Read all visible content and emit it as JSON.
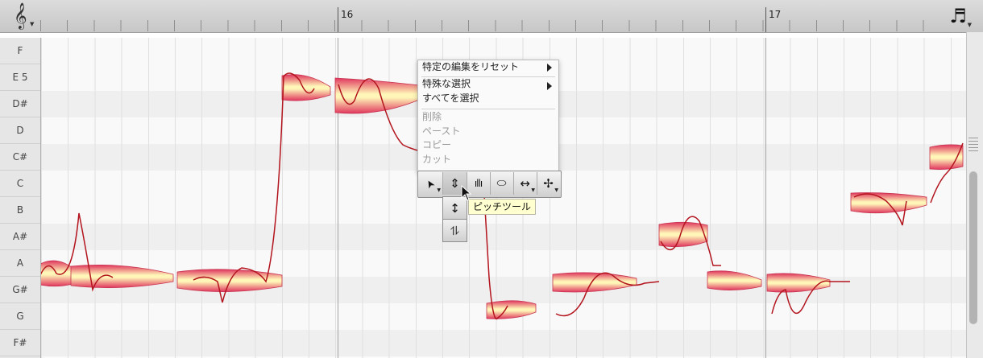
{
  "ruler": {
    "bar_labels": [
      "16",
      "17"
    ],
    "clef_icon": "treble-clef-icon",
    "note_icon": "music-note-icon"
  },
  "keys": [
    "F",
    "E 5",
    "D#",
    "D",
    "C#",
    "C",
    "B",
    "A#",
    "A",
    "G#",
    "G",
    "F#"
  ],
  "context_menu": {
    "items": [
      {
        "label": "特定の編集をリセット",
        "submenu": true,
        "enabled": true
      },
      {
        "label": "特殊な選択",
        "submenu": true,
        "enabled": true
      },
      {
        "label": "すべてを選択",
        "submenu": false,
        "enabled": true
      },
      {
        "label": "削除",
        "submenu": false,
        "enabled": false
      },
      {
        "label": "ペースト",
        "submenu": false,
        "enabled": false
      },
      {
        "label": "コピー",
        "submenu": false,
        "enabled": false
      },
      {
        "label": "カット",
        "submenu": false,
        "enabled": false
      }
    ]
  },
  "toolbar": {
    "tools": [
      {
        "name": "arrow-tool-icon",
        "glyph": "➤"
      },
      {
        "name": "pitch-tool-icon",
        "glyph": "⇕"
      },
      {
        "name": "amplitude-tool-icon",
        "glyph": "ıllı"
      },
      {
        "name": "formant-tool-icon",
        "glyph": "⬭"
      },
      {
        "name": "timing-tool-icon",
        "glyph": "↔"
      },
      {
        "name": "separation-tool-icon",
        "glyph": "✢"
      }
    ],
    "subtools": [
      {
        "name": "pitch-modulation-tool-icon",
        "glyph": "↕"
      },
      {
        "name": "pitch-drift-tool-icon",
        "glyph": "⥮"
      }
    ],
    "tooltip": "ピッチツール"
  },
  "colors": {
    "blob_fill_inner": "#fff6b8",
    "blob_fill_outer": "#e0365e",
    "pitch_curve": "#b3141d",
    "tooltip_bg": "#ffffcf"
  }
}
